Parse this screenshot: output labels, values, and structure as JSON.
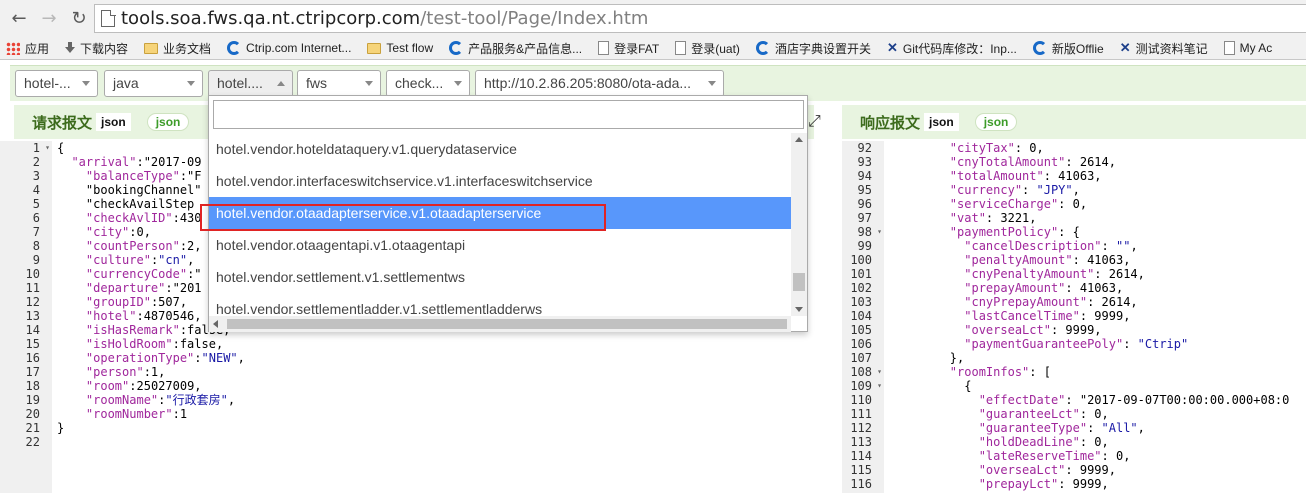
{
  "browser": {
    "url_host": "tools.soa.fws.qa.nt.ctripcorp.com",
    "url_path": "/test-tool/Page/Index.htm",
    "bookmarks": [
      {
        "label": "应用",
        "icon": "apps-grid-icon"
      },
      {
        "label": "下载内容",
        "icon": "download-icon"
      },
      {
        "label": "业务文档",
        "icon": "folder-icon"
      },
      {
        "label": "Ctrip.com Internet...",
        "icon": "ctrip-icon"
      },
      {
        "label": "Test flow",
        "icon": "folder-icon"
      },
      {
        "label": "产品服务&产品信息...",
        "icon": "ctrip-icon"
      },
      {
        "label": "登录FAT",
        "icon": "page-icon"
      },
      {
        "label": "登录(uat)",
        "icon": "page-icon"
      },
      {
        "label": "酒店字典设置开关",
        "icon": "ctrip-icon"
      },
      {
        "label": "Git代码库修改：Inp...",
        "icon": "x-icon"
      },
      {
        "label": "新版Offlie",
        "icon": "ctrip-icon"
      },
      {
        "label": "测试资料笔记",
        "icon": "x-icon"
      },
      {
        "label": "My Ac",
        "icon": "page-icon"
      }
    ]
  },
  "toolbar": {
    "selects": [
      {
        "label": "hotel-..."
      },
      {
        "label": "java"
      },
      {
        "label": "hotel...."
      },
      {
        "label": "fws"
      },
      {
        "label": "check..."
      },
      {
        "label": "http://10.2.86.205:8080/ota-ada..."
      }
    ]
  },
  "request_panel": {
    "title": "请求报文",
    "badge": "json",
    "button": "json"
  },
  "response_panel": {
    "title": "响应报文",
    "badge": "json",
    "button": "json"
  },
  "dropdown": {
    "search_value": "",
    "options": [
      "hotel.vendor.hoteldataquery.v1.querydataservice",
      "hotel.vendor.interfaceswitchservice.v1.interfaceswitchservice",
      "hotel.vendor.otaadapterservice.v1.otaadapterservice",
      "hotel.vendor.otaagentapi.v1.otaagentapi",
      "hotel.vendor.settlement.v1.settlementws",
      "hotel.vendor.settlementladder.v1.settlementladderws"
    ],
    "active_index": 2
  },
  "request_editor": {
    "line_numbers": [
      "1",
      "2",
      "3",
      "4",
      "5",
      "6",
      "7",
      "8",
      "9",
      "10",
      "11",
      "12",
      "13",
      "14",
      "15",
      "16",
      "17",
      "18",
      "19",
      "20",
      "21",
      "22"
    ],
    "lines": [
      "{",
      "  \"arrival\":\"2017-09",
      "    \"balanceType\":\"F",
      "    \"bookingChannel\"",
      "    \"checkAvailStep",
      "    \"checkAvlID\":430",
      "    \"city\":0,",
      "    \"countPerson\":2,",
      "    \"culture\":\"cn\",",
      "    \"currencyCode\":\"",
      "    \"departure\":\"201",
      "    \"groupID\":507,",
      "    \"hotel\":4870546,",
      "    \"isHasRemark\":false,",
      "    \"isHoldRoom\":false,",
      "    \"operationType\":\"NEW\",",
      "    \"person\":1,",
      "    \"room\":25027009,",
      "    \"roomName\":\"行政套房\",",
      "    \"roomNumber\":1",
      "}",
      ""
    ]
  },
  "response_editor": {
    "line_numbers": [
      "92",
      "93",
      "94",
      "95",
      "96",
      "97",
      "98",
      "99",
      "100",
      "101",
      "102",
      "103",
      "104",
      "105",
      "106",
      "107",
      "108",
      "109",
      "110",
      "111",
      "112",
      "113",
      "114",
      "115",
      "116"
    ],
    "lines": [
      "        \"cityTax\": 0,",
      "        \"cnyTotalAmount\": 2614,",
      "        \"totalAmount\": 41063,",
      "        \"currency\": \"JPY\",",
      "        \"serviceCharge\": 0,",
      "        \"vat\": 3221,",
      "        \"paymentPolicy\": {",
      "          \"cancelDescription\": \"\",",
      "          \"penaltyAmount\": 41063,",
      "          \"cnyPenaltyAmount\": 2614,",
      "          \"prepayAmount\": 41063,",
      "          \"cnyPrepayAmount\": 2614,",
      "          \"lastCancelTime\": 9999,",
      "          \"overseaLct\": 9999,",
      "          \"paymentGuaranteePoly\": \"Ctrip\"",
      "        },",
      "        \"roomInfos\": [",
      "          {",
      "            \"effectDate\": \"2017-09-07T00:00:00.000+08:0",
      "            \"guaranteeLct\": 0,",
      "            \"guaranteeType\": \"All\",",
      "            \"holdDeadLine\": 0,",
      "            \"lateReserveTime\": 0,",
      "            \"overseaLct\": 9999,",
      "            \"prepayLct\": 9999,"
    ]
  }
}
